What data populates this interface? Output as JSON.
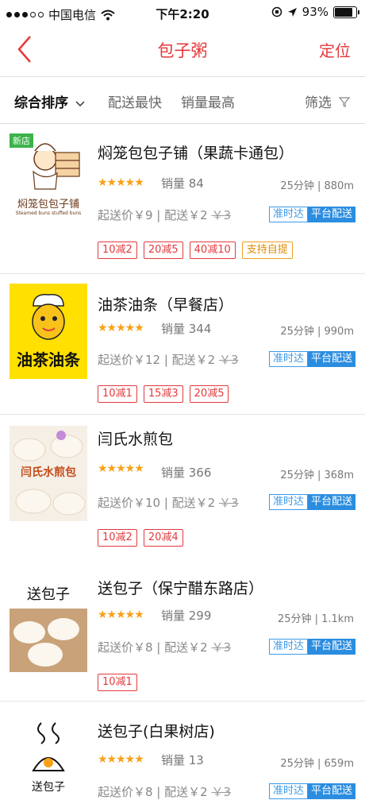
{
  "status": {
    "carrier": "中国电信",
    "time": "下午2:20",
    "battery": "93%"
  },
  "nav": {
    "title": "包子粥",
    "locate": "定位"
  },
  "filters": {
    "sort": "综合排序",
    "fastest": "配送最快",
    "top_sales": "销量最高",
    "filter": "筛选"
  },
  "icons": {
    "back": "chevron-left-icon",
    "filter": "funnel-icon",
    "star": "★"
  },
  "colors": {
    "accent": "#e4393c",
    "blue": "#2b8de0",
    "star": "#f8a117",
    "new": "#3bb34a"
  },
  "shops": [
    {
      "name": "焖笼包包子铺（果蔬卡通包）",
      "stars": "★★★★★",
      "sales": "销量 84",
      "time_dist": "25分钟 | 880m",
      "fee": "起送价￥9 | 配送￥2",
      "old_fee": "￥3",
      "ontime": "准时达",
      "platform": "平台配送",
      "logo_text": "焖笼包包子铺",
      "logo_sub": "Steamed buns stuffed buns",
      "new_tag": "新店",
      "promos": [
        "10减2",
        "20减5",
        "40减10",
        "支持自提"
      ]
    },
    {
      "name": "油茶油条（早餐店）",
      "stars": "★★★★★",
      "sales": "销量 344",
      "time_dist": "25分钟 | 990m",
      "fee": "起送价￥12 | 配送￥2",
      "old_fee": "￥3",
      "ontime": "准时达",
      "platform": "平台配送",
      "logo_text": "油茶油条",
      "promos": [
        "10减1",
        "15减3",
        "20减5"
      ]
    },
    {
      "name": "闫氏水煎包",
      "stars": "★★★★★",
      "sales": "销量 366",
      "time_dist": "25分钟 | 368m",
      "fee": "起送价￥10 | 配送￥2",
      "old_fee": "￥3",
      "ontime": "准时达",
      "platform": "平台配送",
      "logo_text": "闫氏水煎包",
      "promos": [
        "10减2",
        "20减4"
      ]
    },
    {
      "name": "送包子（保宁醋东路店）",
      "stars": "★★★★★",
      "sales": "销量 299",
      "time_dist": "25分钟 | 1.1km",
      "fee": "起送价￥8 | 配送￥2",
      "old_fee": "￥3",
      "ontime": "准时达",
      "platform": "平台配送",
      "logo_text": "送包子",
      "promos": [
        "10减1"
      ]
    },
    {
      "name": "送包子(白果树店)",
      "stars": "★★★★★",
      "sales": "销量 13",
      "time_dist": "25分钟 | 659m",
      "fee": "起送价￥8 | 配送￥2",
      "old_fee": "￥3",
      "ontime": "准时达",
      "platform": "平台配送",
      "logo_text": "送包子",
      "promos": []
    }
  ]
}
